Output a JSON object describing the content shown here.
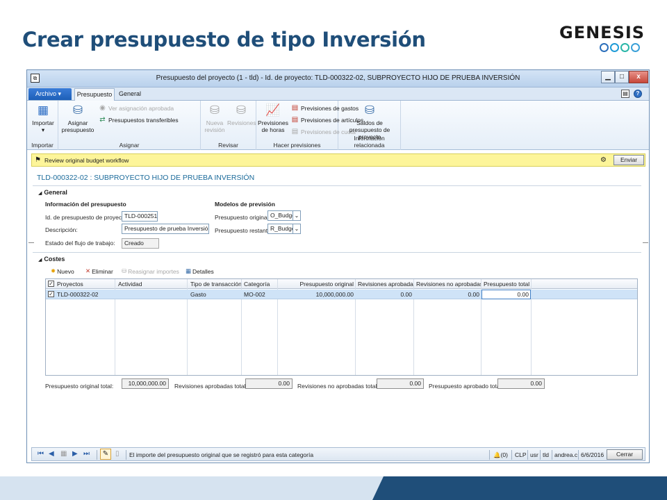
{
  "slide": {
    "title": "Crear presupuesto de tipo Inversión",
    "logo_text": "GENESIS",
    "title_color": "#1f4e79"
  },
  "window": {
    "title": "Presupuesto del proyecto (1 - tld) - Id. de proyecto: TLD-000322-02, SUBPROYECTO HIJO DE PRUEBA INVERSIÓN",
    "min_label": "▁",
    "max_label": "□",
    "close_label": "x"
  },
  "ribbon_tabs": {
    "archivo": "Archivo",
    "presupuesto": "Presupuesto",
    "general": "General"
  },
  "ribbon": {
    "importar_group": {
      "button": "Importar",
      "label": "Importar"
    },
    "asignar_group": {
      "asignar_button": "Asignar presupuesto",
      "ver_asignacion": "Ver asignación aprobada",
      "transferibles": "Presupuestos transferibles",
      "label": "Asignar"
    },
    "revisar_group": {
      "nueva_revision": "Nueva revisión",
      "revisiones": "Revisiones",
      "label": "Revisar"
    },
    "previsiones_group": {
      "horas": "Previsiones de horas",
      "gastos": "Previsiones de gastos",
      "articulos": "Previsiones de artículos",
      "cuota": "Previsiones de cuota",
      "label": "Hacer previsiones"
    },
    "info_group": {
      "saldos": "Saldos de presupuesto de proyecto",
      "label": "Información relacionada"
    }
  },
  "workflow": {
    "message": "Review original budget workflow",
    "submit_label": "Enviar"
  },
  "record": {
    "title": "TLD-000322-02 : SUBPROYECTO HIJO DE PRUEBA INVERSIÓN"
  },
  "general": {
    "section_label": "General",
    "info_heading": "Información del presupuesto",
    "id_label": "Id. de presupuesto de proyecto:",
    "id_value": "TLD-000251",
    "desc_label": "Descripción:",
    "desc_value": "Presupuesto de prueba Inversión",
    "estado_label": "Estado del flujo de trabajo:",
    "estado_value": "Creado",
    "models_heading": "Modelos de previsión",
    "original_label": "Presupuesto original:",
    "original_value": "O_Budget",
    "restante_label": "Presupuesto restante:",
    "restante_value": "R_Budget"
  },
  "costes": {
    "section_label": "Costes",
    "toolbar": {
      "nuevo": "Nuevo",
      "eliminar": "Eliminar",
      "reasignar": "Reasignar importes",
      "detalles": "Detalles"
    },
    "columns": [
      "Proyectos",
      "Actividad",
      "Tipo de transacción",
      "Categoría",
      "Presupuesto original",
      "Revisiones aprobadas",
      "Revisiones no aprobadas",
      "Presupuesto total"
    ],
    "rows": [
      [
        "TLD-000322-02",
        "",
        "Gasto",
        "MO-002",
        "10,000,000.00",
        "0.00",
        "0.00",
        "0.00"
      ]
    ]
  },
  "totals": {
    "original_label": "Presupuesto original total:",
    "original_value": "10,000,000.00",
    "aprobadas_label": "Revisiones aprobadas totales:",
    "aprobadas_value": "0.00",
    "no_aprobadas_label": "Revisiones no aprobadas totales:",
    "no_aprobadas_value": "0.00",
    "aprobado_label": "Presupuesto aprobado total:",
    "aprobado_value": "0.00"
  },
  "statusbar": {
    "message": "El importe del presupuesto original que se registró para esta categoría",
    "alerts": "(0)",
    "currency": "CLP",
    "user": "usr",
    "company": "tld",
    "account": "andrea.c",
    "date": "6/6/2016",
    "close_label": "Cerrar"
  }
}
